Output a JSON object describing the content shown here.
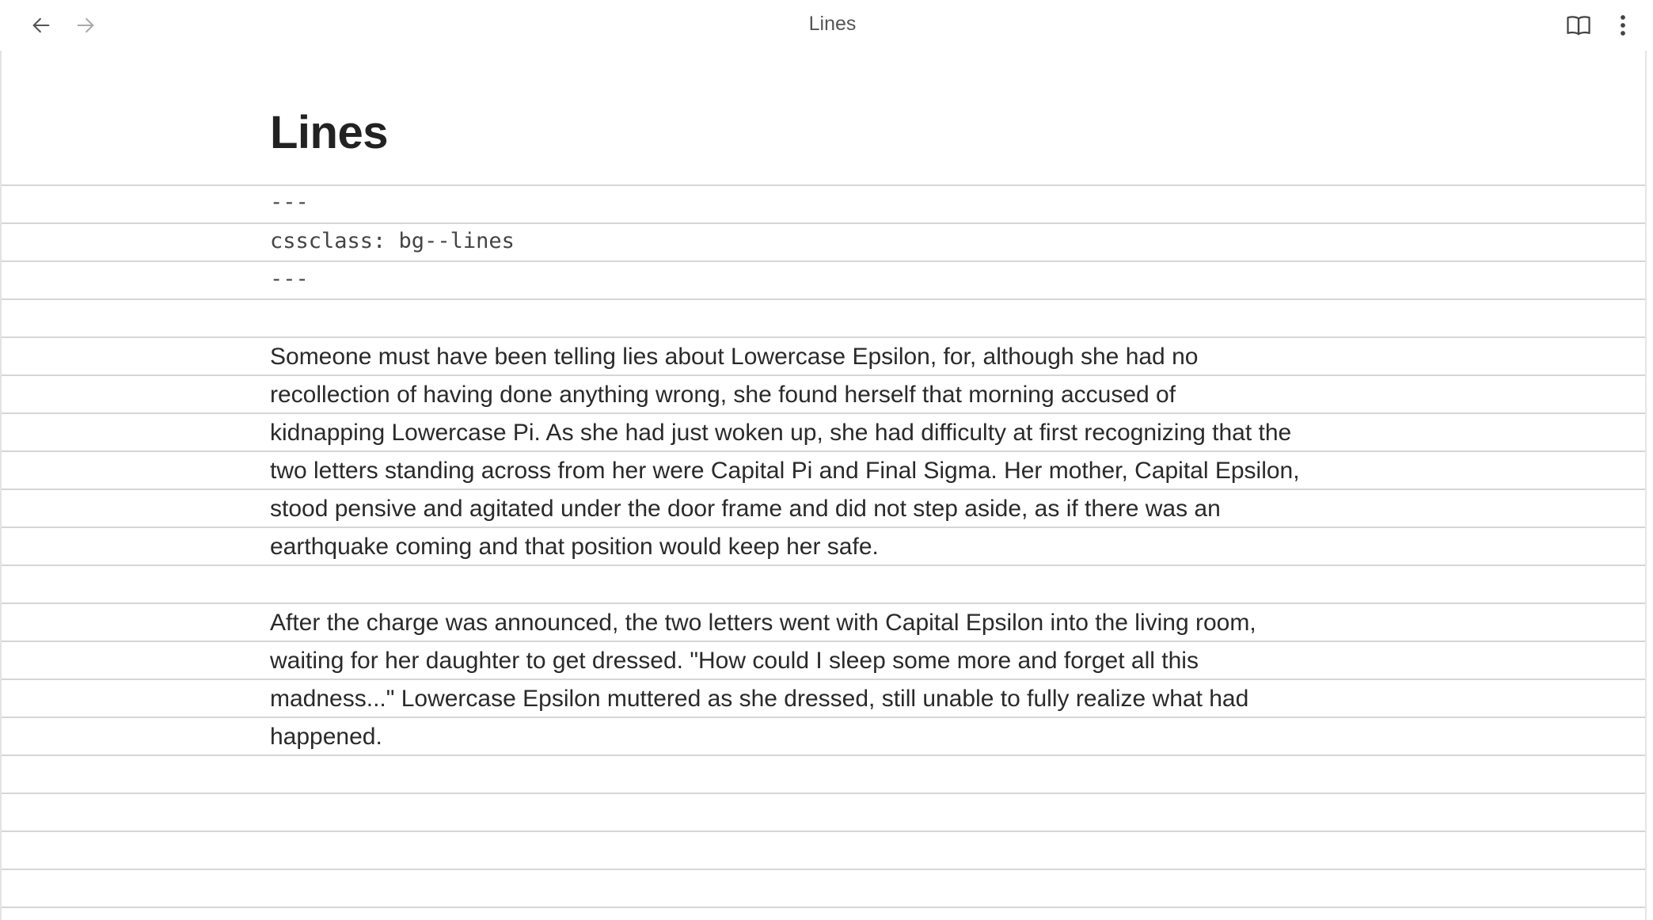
{
  "titlebar": {
    "view_title": "Lines",
    "back_icon": "arrow-left-icon",
    "forward_icon": "arrow-right-icon",
    "reading_view_icon": "book-open-icon",
    "more_icon": "more-vertical-icon"
  },
  "document": {
    "title": "Lines",
    "frontmatter": [
      "---",
      "cssclass: bg--lines",
      "---"
    ],
    "paragraphs": [
      {
        "lines": [
          "Someone must have been telling lies about Lowercase Epsilon, for, although she had no",
          "recollection of having done anything wrong, she found herself that morning accused of",
          "kidnapping Lowercase Pi. As she had just woken up, she had difficulty at first recognizing that the",
          "two letters standing across from her were Capital Pi and Final Sigma. Her mother, Capital Epsilon,",
          "stood pensive and agitated under the door frame and did not step aside, as if there was an",
          "earthquake coming and that position would keep her safe."
        ]
      },
      {
        "lines": [
          "After the charge was announced, the two letters went with Capital Epsilon into the living room,",
          "waiting for her daughter to get dressed. \"How could I sleep some more and forget all this",
          "madness...\" Lowercase Epsilon muttered as she dressed, still unable to fully realize what had",
          "happened."
        ]
      }
    ]
  },
  "colors": {
    "text": "#2a2a2a",
    "rule_line": "#d6d6d6",
    "muted": "#555555"
  }
}
